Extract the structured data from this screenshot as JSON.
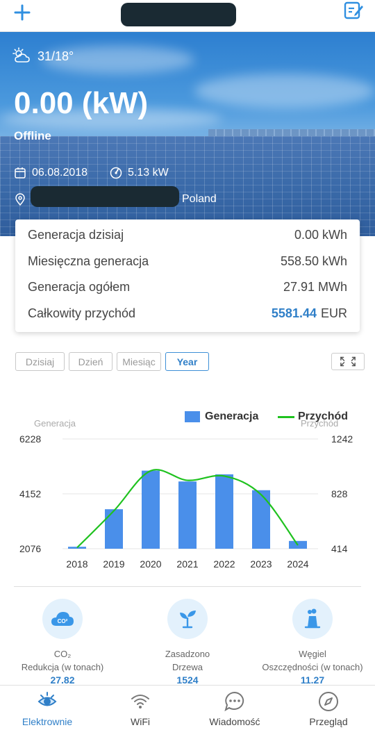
{
  "weather": {
    "temp": "31/18°",
    "icon": "partly-cloudy-icon"
  },
  "plant": {
    "power": "0.00 (kW)",
    "status": "Offline",
    "date": "06.08.2018",
    "capacity": "5.13 kW",
    "country": "Poland"
  },
  "summary": {
    "rows": [
      {
        "label": "Generacja dzisiaj",
        "value": "0.00 kWh"
      },
      {
        "label": "Miesięczna generacja",
        "value": "558.50 kWh"
      },
      {
        "label": "Generacja ogółem",
        "value": "27.91 MWh"
      },
      {
        "label": "Całkowity przychód",
        "value": "5581.44",
        "unit": "EUR"
      }
    ]
  },
  "tabs": [
    {
      "label": "Dzisiaj",
      "active": false
    },
    {
      "label": "Dzień",
      "active": false
    },
    {
      "label": "Miesiąc",
      "active": false
    },
    {
      "label": "Year",
      "active": true
    }
  ],
  "chart_data": {
    "type": "bar",
    "categories": [
      "2018",
      "2019",
      "2020",
      "2021",
      "2022",
      "2023",
      "2024"
    ],
    "series": [
      {
        "name": "Generacja",
        "type": "bar",
        "axis": "left",
        "color": "#4a8fea",
        "values": [
          2150,
          3570,
          5030,
          4620,
          4890,
          4290,
          2370
        ]
      },
      {
        "name": "Przychód",
        "type": "line",
        "axis": "right",
        "color": "#1fc21f",
        "values": [
          422,
          700,
          1002,
          930,
          962,
          822,
          440
        ]
      }
    ],
    "ylabel": "Generacja",
    "ylabel_right": "Przychód",
    "yticks_left": [
      "6228",
      "4152",
      "2076"
    ],
    "yticks_right": [
      "1242",
      "828",
      "414"
    ],
    "ylim": [
      2076,
      6228
    ],
    "ylim_right": [
      414,
      1242
    ],
    "legend": "top-right",
    "grid": true
  },
  "eco": [
    {
      "label_line1": "CO₂",
      "label_line2": "Redukcja (w tonach)",
      "value": "27.82",
      "icon": "co2-cloud-icon"
    },
    {
      "label_line1": "Zasadzono",
      "label_line2": "Drzewa",
      "value": "1524",
      "icon": "seedling-icon"
    },
    {
      "label_line1": "Węgiel",
      "label_line2": "Oszczędności (w tonach)",
      "value": "11.27",
      "icon": "power-plant-icon"
    }
  ],
  "nav": [
    {
      "label": "Elektrownie",
      "icon": "eye-icon",
      "active": true
    },
    {
      "label": "WiFi",
      "icon": "wifi-icon",
      "active": false
    },
    {
      "label": "Wiadomość",
      "icon": "message-icon",
      "active": false
    },
    {
      "label": "Przegląd",
      "icon": "compass-icon",
      "active": false
    }
  ],
  "colors": {
    "accent": "#2f7fc8",
    "bar": "#4a8fea",
    "line": "#1fc21f"
  }
}
